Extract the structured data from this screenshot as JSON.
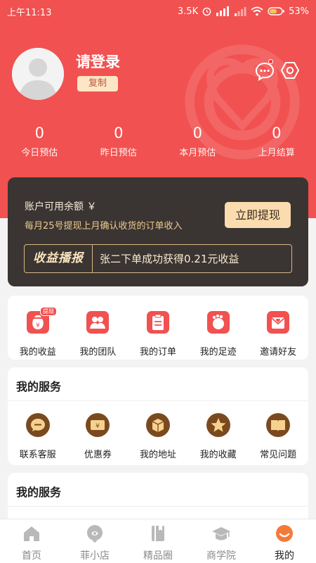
{
  "status_bar": {
    "time": "上午11:13",
    "net_speed": "3.5K",
    "battery": "53%"
  },
  "profile": {
    "title": "请登录",
    "copy_label": "复制"
  },
  "stats": [
    {
      "value": "0",
      "label": "今日预估"
    },
    {
      "value": "0",
      "label": "昨日预估"
    },
    {
      "value": "0",
      "label": "本月预估"
    },
    {
      "value": "0",
      "label": "上月结算"
    }
  ],
  "balance": {
    "label": "账户可用余额 ￥",
    "note": "每月25号提现上月确认收货的订单收入",
    "withdraw_label": "立即提现",
    "broadcast_tag": "收益播报",
    "broadcast_text": "张二下单成功获得0.21元收益"
  },
  "quick_menu": {
    "badge": "提现",
    "items": [
      {
        "label": "我的收益",
        "icon": "money-bag-icon"
      },
      {
        "label": "我的团队",
        "icon": "team-icon"
      },
      {
        "label": "我的订单",
        "icon": "order-icon"
      },
      {
        "label": "我的足迹",
        "icon": "footprint-icon"
      },
      {
        "label": "邀请好友",
        "icon": "invite-icon"
      }
    ]
  },
  "services": {
    "title": "我的服务",
    "items": [
      {
        "label": "联系客服",
        "icon": "chat-icon"
      },
      {
        "label": "优惠券",
        "icon": "coupon-icon"
      },
      {
        "label": "我的地址",
        "icon": "address-icon"
      },
      {
        "label": "我的收藏",
        "icon": "star-icon"
      },
      {
        "label": "常见问题",
        "icon": "book-icon"
      }
    ]
  },
  "services2": {
    "title": "我的服务"
  },
  "tabbar": {
    "active": 4,
    "items": [
      {
        "label": "首页",
        "icon": "home-icon"
      },
      {
        "label": "菲小店",
        "icon": "shop-icon"
      },
      {
        "label": "精品圈",
        "icon": "book-icon"
      },
      {
        "label": "商学院",
        "icon": "graduation-cap-icon"
      },
      {
        "label": "我的",
        "icon": "profile-icon"
      }
    ]
  },
  "colors": {
    "brand_red": "#f15150",
    "dark_card": "#3a3533",
    "gold": "#fbdcae",
    "service_brown": "#7a4a1e"
  }
}
